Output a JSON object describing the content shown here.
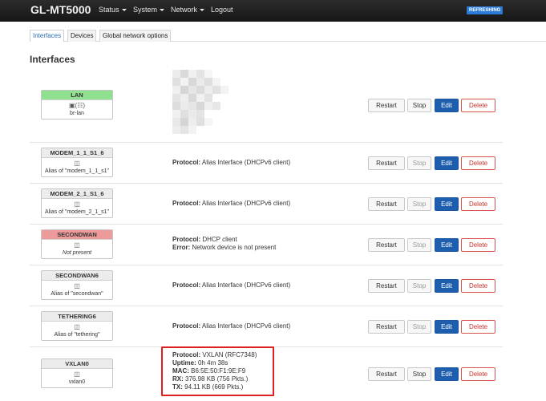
{
  "header": {
    "brand": "GL-MT5000",
    "nav": [
      "Status",
      "System",
      "Network",
      "Logout"
    ],
    "refresh_badge": "REFRESHING"
  },
  "tabs": [
    "Interfaces",
    "Devices",
    "Global network options"
  ],
  "page_title": "Interfaces",
  "buttons": {
    "restart": "Restart",
    "stop": "Stop",
    "edit": "Edit",
    "delete": "Delete"
  },
  "interfaces": [
    {
      "name": "LAN",
      "sub": "br-lan",
      "icon": "network-bridge-icon",
      "lines": []
    },
    {
      "name": "MODEM_1_1_S1_6",
      "sub": "Alias of \"modem_1_1_s1\"",
      "icon": "alias-icon",
      "lines": [
        {
          "label": "Protocol:",
          "value": "Alias Interface (DHCPv6 client)"
        }
      ]
    },
    {
      "name": "MODEM_2_1_S1_6",
      "sub": "Alias of \"modem_2_1_s1\"",
      "icon": "alias-icon",
      "lines": [
        {
          "label": "Protocol:",
          "value": "Alias Interface (DHCPv6 client)"
        }
      ]
    },
    {
      "name": "SECONDWAN",
      "sub": "Not present",
      "icon": "alias-icon",
      "lines": [
        {
          "label": "Protocol:",
          "value": "DHCP client"
        },
        {
          "label": "Error:",
          "value": "Network device is not present"
        }
      ]
    },
    {
      "name": "SECONDWAN6",
      "sub": "Alias of \"secondwan\"",
      "icon": "alias-icon",
      "lines": [
        {
          "label": "Protocol:",
          "value": "Alias Interface (DHCPv6 client)"
        }
      ]
    },
    {
      "name": "TETHERING6",
      "sub": "Alias of \"tethering\"",
      "icon": "alias-icon",
      "lines": [
        {
          "label": "Protocol:",
          "value": "Alias Interface (DHCPv6 client)"
        }
      ]
    },
    {
      "name": "VXLAN0",
      "sub": "vxlan0",
      "icon": "alias-icon",
      "lines": [
        {
          "label": "Protocol:",
          "value": "VXLAN (RFC7348)"
        },
        {
          "label": "Uptime:",
          "value": "0h 4m 38s"
        },
        {
          "label": "MAC:",
          "value": "B6:5E:50:F1:9E:F9"
        },
        {
          "label": "RX:",
          "value": "376.98 KB (756 Pkts.)"
        },
        {
          "label": "TX:",
          "value": "94.11 KB (669 Pkts.)"
        }
      ]
    }
  ]
}
